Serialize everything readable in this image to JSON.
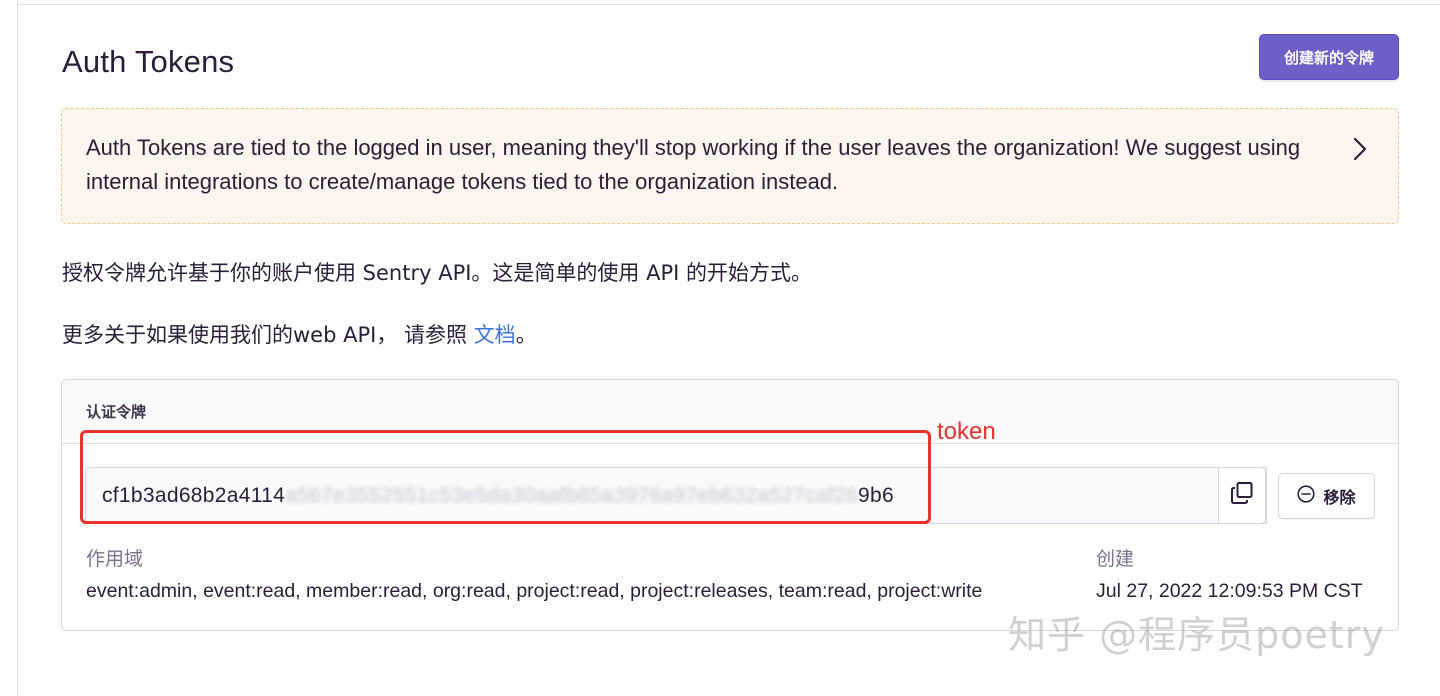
{
  "page": {
    "title": "Auth Tokens",
    "create_button_label": "创建新的令牌"
  },
  "alert": {
    "text": "Auth Tokens are tied to the logged in user, meaning they'll stop working if the user leaves the organization! We suggest using internal integrations to create/manage tokens tied to the organization instead.",
    "chevron_icon": "chevron-right-icon"
  },
  "intro": {
    "line1": "授权令牌允许基于你的账户使用 Sentry API。这是简单的使用 API 的开始方式。",
    "line2_prefix": "更多关于如果使用我们的web API， 请参照 ",
    "line2_link": "文档",
    "line2_suffix": "。"
  },
  "token_panel": {
    "header": "认证令牌",
    "token_visible_start": "cf1b3ad68b2a4114",
    "token_obscured": "a567e3552551c53e5da30aafb85a3976a97eb632a527caf26",
    "token_visible_end": "9b6",
    "copy_icon": "copy-icon",
    "remove_icon": "minus-circle-icon",
    "remove_label": "移除",
    "scope_label": "作用域",
    "scope_value": "event:admin, event:read, member:read, org:read, project:read, project:releases, team:read, project:write",
    "created_label": "创建",
    "created_value": "Jul 27, 2022 12:09:53 PM CST"
  },
  "annotation": {
    "label": "token",
    "color": "#e8322a"
  },
  "watermark": {
    "text": "知乎 @程序员poetry"
  },
  "colors": {
    "accent": "#6c5fc7",
    "alert_bg": "#fdf6ee",
    "alert_border": "#f2c48a",
    "link": "#3d74db"
  }
}
